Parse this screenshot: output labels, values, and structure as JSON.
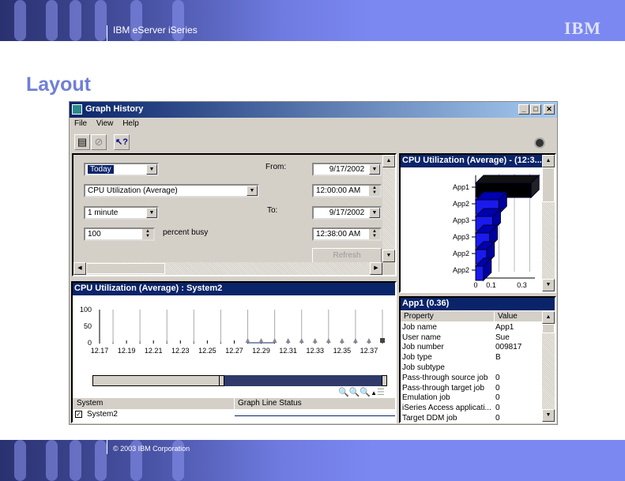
{
  "banner": {
    "product": "IBM eServer iSeries",
    "logo": "IBM"
  },
  "slide_title": "Layout",
  "footer": {
    "copyright": "© 2003 IBM Corporation"
  },
  "window": {
    "title": "Graph History",
    "menu": [
      "File",
      "View",
      "Help"
    ],
    "toolbar": [
      "properties-icon",
      "refresh-icon",
      "context-help-icon"
    ],
    "controls": {
      "range": "Today",
      "metric": "CPU Utilization (Average)",
      "interval": "1 minute",
      "threshold": "100",
      "threshold_label": "percent busy",
      "from_label": "From:",
      "from_date": "9/17/2002",
      "from_time": "12:00:00 AM",
      "to_label": "To:",
      "to_date": "9/17/2002",
      "to_time": "12:38:00 AM",
      "refresh": "Refresh"
    },
    "graph": {
      "title": "CPU Utilization (Average) : System2",
      "yticks": [
        "100",
        "50",
        "0"
      ],
      "xticks": [
        "12.17",
        "12.19",
        "12.21",
        "12.23",
        "12.25",
        "12.27",
        "12.29",
        "12.31",
        "12.33",
        "12.35",
        "12.37"
      ],
      "list_headers": [
        "System",
        "Graph Line Status"
      ],
      "systems": [
        {
          "name": "System2",
          "checked": true
        }
      ]
    },
    "bar_panel": {
      "title": "CPU Utilization (Average) - (12:3...",
      "xticks": [
        "0",
        "0.1",
        "0.3"
      ]
    },
    "details": {
      "title": "App1 (0.36)",
      "headers": [
        "Property",
        "Value"
      ],
      "rows": [
        [
          "Job name",
          "App1"
        ],
        [
          "User name",
          "Sue"
        ],
        [
          "Job number",
          "009817"
        ],
        [
          "Job type",
          "B"
        ],
        [
          "Job subtype",
          ""
        ],
        [
          "Pass-through source job",
          "0"
        ],
        [
          "Pass-through target job",
          "0"
        ],
        [
          "Emulation job",
          "0"
        ],
        [
          "iSeries Access applicati...",
          "0"
        ],
        [
          "Target DDM job",
          "0"
        ]
      ]
    }
  },
  "chart_data": [
    {
      "type": "line",
      "title": "CPU Utilization (Average) : System2",
      "xlabel": "",
      "ylabel": "",
      "ylim": [
        0,
        100
      ],
      "x": [
        12.28,
        12.29,
        12.3,
        12.31,
        12.32,
        12.33,
        12.34,
        12.35,
        12.36,
        12.37,
        12.38
      ],
      "series": [
        {
          "name": "System2",
          "values": [
            0,
            0,
            0,
            0,
            0,
            0,
            0,
            0,
            0,
            0,
            0
          ]
        }
      ],
      "xlim": [
        12.17,
        12.38
      ]
    },
    {
      "type": "bar",
      "orientation": "horizontal",
      "title": "CPU Utilization (Average) - (12:3...",
      "categories": [
        "App1",
        "App2",
        "App3",
        "App3",
        "App2",
        "App2"
      ],
      "values": [
        0.36,
        0.15,
        0.11,
        0.09,
        0.07,
        0.05
      ],
      "xlim": [
        0,
        0.35
      ]
    }
  ]
}
